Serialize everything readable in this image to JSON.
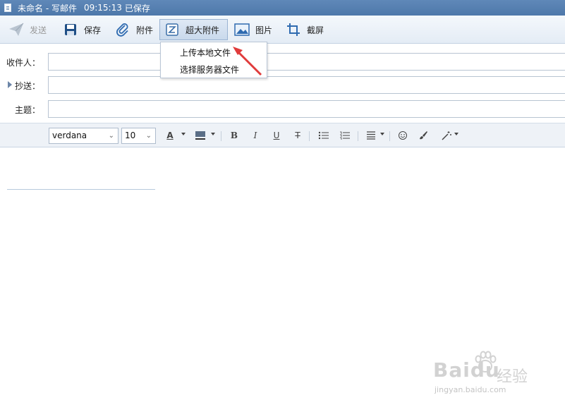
{
  "window": {
    "name": "未命名 - 写邮件",
    "time": "09:15:13",
    "status": "已保存"
  },
  "toolbar": {
    "send": "发送",
    "save": "保存",
    "attach": "附件",
    "super_attach": "超大附件",
    "image": "图片",
    "screenshot": "截屏"
  },
  "dropdown": {
    "items": [
      "上传本地文件",
      "选择服务器文件"
    ]
  },
  "fields": {
    "to_label": "收件人：",
    "cc_label": "抄送：",
    "subject_label": "主题：",
    "to_value": "",
    "cc_value": "",
    "subject_value": ""
  },
  "format": {
    "font": "verdana",
    "size": "10"
  },
  "watermark": {
    "brand": "Baidu",
    "jingyan": "经验",
    "url": "jingyan.baidu.com"
  },
  "colors": {
    "titlebar": "#5f88b8",
    "arrow": "#e03b3b"
  }
}
